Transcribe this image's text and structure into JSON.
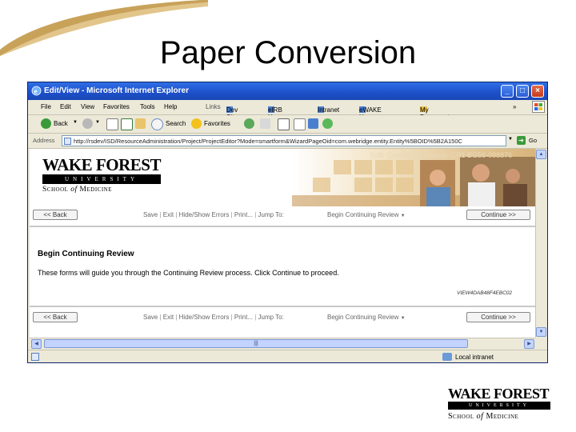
{
  "slide": {
    "title": "Paper Conversion"
  },
  "window": {
    "title": "Edit/View - Microsoft Internet Explorer",
    "menu": [
      "File",
      "Edit",
      "View",
      "Favorites",
      "Tools",
      "Help"
    ],
    "links_label": "Links",
    "links": [
      "Dev Site",
      "eIRB Home",
      "Intranet",
      "eWAKE Home",
      "My Documents"
    ],
    "toolbar": {
      "back": "Back",
      "search": "Search",
      "favorites": "Favorites"
    },
    "address_label": "Address",
    "address_url": "http://rsdev/ISD/ResourceAdministration/Project/ProjectEditor?Mode=smartform&WizardPageOid=com.webridge.entity.Entity%5BOID%5B2A150C",
    "go_label": "Go",
    "status_zone": "Local intranet"
  },
  "banner": {
    "wake_forest": "WAKE FOREST",
    "university": "UNIVERSITY",
    "school_pre": "School ",
    "school_of": "of",
    "school_post": " Medicine",
    "edit_label": "Edit: Continuing Review: CR1 BG56-098876"
  },
  "nav": {
    "back": "<< Back",
    "continue": "Continue >>",
    "links": [
      "Save",
      "Exit",
      "Hide/Show Errors",
      "Print...",
      "Jump To:"
    ],
    "jump_value": "Begin Continuing Review"
  },
  "page": {
    "title": "Begin Continuing Review",
    "text": "These forms will guide you through the Continuing Review process.  Click Continue to proceed.",
    "code": "VIEW4DAB48F4EBC02"
  },
  "footer_logo": {
    "wake_forest": "WAKE FOREST",
    "university": "UNIVERSITY",
    "school_pre": "School ",
    "school_of": "of",
    "school_post": " Medicine"
  }
}
